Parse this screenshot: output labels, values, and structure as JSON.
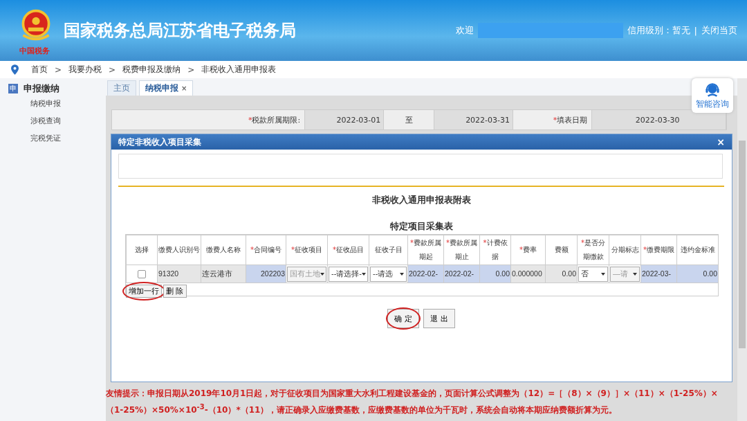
{
  "header": {
    "title": "国家税务总局江苏省电子税务局",
    "emblem_caption": "中国税务",
    "welcome": "欢迎",
    "credit": "信用级别：暂无",
    "divider": "|",
    "close": "关闭当页"
  },
  "breadcrumb": [
    {
      "kind": "link",
      "text": "首页"
    },
    {
      "kind": "sep",
      "text": ">"
    },
    {
      "kind": "link",
      "text": "我要办税"
    },
    {
      "kind": "sep",
      "text": ">"
    },
    {
      "kind": "link",
      "text": "税费申报及缴纳"
    },
    {
      "kind": "sep",
      "text": ">"
    },
    {
      "kind": "link",
      "text": "非税收入通用申报表"
    }
  ],
  "sidebar": {
    "section": "申报缴纳",
    "section_icon": "申",
    "items": [
      {
        "label": "纳税申报",
        "selected": false
      },
      {
        "label": "涉税查询",
        "selected": false
      },
      {
        "label": "完税凭证",
        "selected": false
      }
    ]
  },
  "tabs": [
    {
      "label": "主页",
      "selected": false,
      "closable": false
    },
    {
      "label": "纳税申报",
      "selected": true,
      "closable": true
    }
  ],
  "close_glyph": "×",
  "assistant": {
    "label": "智能咨询"
  },
  "period_row": [
    {
      "kind": "label",
      "mark": "*",
      "text": "税款所属期限:"
    },
    {
      "kind": "value",
      "text": "2022-03-01"
    },
    {
      "kind": "center",
      "text": "至"
    },
    {
      "kind": "value",
      "text": "2022-03-31"
    },
    {
      "kind": "label",
      "mark": "*",
      "text": "填表日期"
    },
    {
      "kind": "value",
      "text": "2022-03-30"
    }
  ],
  "dialog": {
    "title": "特定非税收入项目采集",
    "close": "×",
    "heading": "非税收入通用申报表附表",
    "subheading": "特定项目采集表",
    "columns": [
      {
        "label": "选择"
      },
      {
        "label": "缴费人识别号"
      },
      {
        "label": "缴费人名称"
      },
      {
        "label": "合同编号",
        "mark": "*"
      },
      {
        "label": "征收项目",
        "mark": "*"
      },
      {
        "label": "征收品目",
        "mark": "*"
      },
      {
        "label": "征收子目"
      },
      {
        "label": "费款所属期起",
        "mark": "*"
      },
      {
        "label": "费款所属期止",
        "mark": "*"
      },
      {
        "label": "计费依据",
        "mark": "*"
      },
      {
        "label": "费率",
        "mark": "*"
      },
      {
        "label": "费额"
      },
      {
        "label": "是否分期缴款",
        "mark": "*"
      },
      {
        "label": "分期标志"
      },
      {
        "label": "缴费期限",
        "mark": "*"
      },
      {
        "label": "违约金标准"
      }
    ],
    "rows": [
      {
        "cells": [
          {
            "kind": "checkbox",
            "checked": false
          },
          {
            "kind": "readonly",
            "text": "91320"
          },
          {
            "kind": "readonly",
            "text": "连云港市"
          },
          {
            "kind": "input_number",
            "text": "202203"
          },
          {
            "kind": "select",
            "text": "国有土地",
            "disabled": true
          },
          {
            "kind": "select",
            "text": "--请选择-",
            "disabled": false
          },
          {
            "kind": "select",
            "text": "--请选",
            "disabled": false
          },
          {
            "kind": "input",
            "text": "2022-02-"
          },
          {
            "kind": "input",
            "text": "2022-02-"
          },
          {
            "kind": "input_number",
            "text": "0.00"
          },
          {
            "kind": "readonly",
            "text": "0.000000"
          },
          {
            "kind": "readonly_number",
            "text": "0.00"
          },
          {
            "kind": "select",
            "text": "否",
            "disabled": false
          },
          {
            "kind": "select",
            "text": "—请",
            "disabled": true
          },
          {
            "kind": "input",
            "text": "2022-03-"
          },
          {
            "kind": "input_number",
            "text": "0.00"
          }
        ]
      }
    ],
    "row_buttons": [
      {
        "label": "增加一行",
        "circled": true
      },
      {
        "label": "删 除",
        "circled": false
      }
    ],
    "buttons": [
      {
        "label": "确 定",
        "circled": true
      },
      {
        "label": "退 出",
        "circled": false
      }
    ]
  },
  "notice": "友情提示：申报日期从2019年10月1日起，对于征收项目为国家重大水利工程建设基金的，页面计算公式调整为（12）=［（8）×（9）］×（11）×（1-25%）×（1-25%）×50%×10$^{-3}$-（10）*（11），请正确录入应缴费基数，应缴费基数的单位为千瓦时，系统会自动将本期应纳费额折算为元。"
}
